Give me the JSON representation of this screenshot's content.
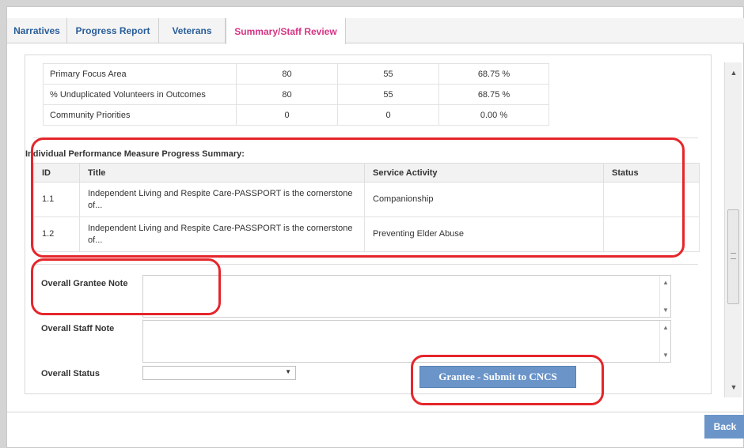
{
  "tabs": [
    {
      "label": "Narratives",
      "active": false
    },
    {
      "label": "Progress Report",
      "active": false
    },
    {
      "label": "Veterans",
      "active": false
    },
    {
      "label": "Summary/Staff Review",
      "active": true
    }
  ],
  "focus_table": {
    "rows": [
      {
        "label": "Primary Focus Area",
        "v1": "80",
        "v2": "55",
        "pct": "68.75 %"
      },
      {
        "label": "% Unduplicated Volunteers in Outcomes",
        "v1": "80",
        "v2": "55",
        "pct": "68.75 %"
      },
      {
        "label": "Community Priorities",
        "v1": "0",
        "v2": "0",
        "pct": "0.00 %"
      }
    ]
  },
  "ipm_summary": {
    "title": "Individual Performance Measure Progress Summary:",
    "headers": {
      "id": "ID",
      "title": "Title",
      "activity": "Service Activity",
      "status": "Status"
    },
    "rows": [
      {
        "id": "1.1",
        "title": "Independent Living and Respite Care-PASSPORT is the cornerstone of...",
        "activity": "Companionship",
        "status": ""
      },
      {
        "id": "1.2",
        "title": "Independent Living and Respite Care-PASSPORT is the cornerstone of...",
        "activity": "Preventing Elder Abuse",
        "status": ""
      }
    ]
  },
  "form": {
    "grantee_note_label": "Overall Grantee Note",
    "grantee_note_value": "",
    "staff_note_label": "Overall Staff Note",
    "staff_note_value": "",
    "status_label": "Overall Status",
    "status_value": ""
  },
  "buttons": {
    "submit_label": "Grantee - Submit to CNCS",
    "back_label": "Back"
  },
  "colors": {
    "active_tab": "#d63384",
    "tab_text": "#2a5e99",
    "button": "#6b95c9",
    "highlight": "#e5262b"
  }
}
